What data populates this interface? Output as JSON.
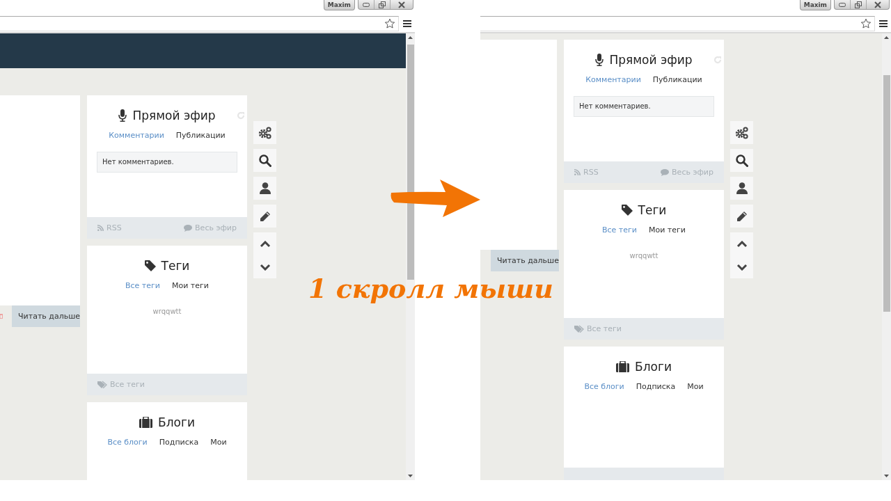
{
  "panels": [
    {
      "kind": "before",
      "user_button": "Maxim",
      "read_more": "Читать дальше",
      "live": {
        "title": "Прямой эфир",
        "tabs": [
          {
            "label": "Комментарии",
            "selected": true
          },
          {
            "label": "Публикации",
            "selected": false
          }
        ],
        "message": "Нет комментариев.",
        "footer": [
          "RSS",
          "Весь эфир"
        ]
      },
      "tags": {
        "title": "Теги",
        "tabs": [
          {
            "label": "Все теги",
            "selected": true
          },
          {
            "label": "Мои теги",
            "selected": false
          }
        ],
        "items": [
          "wrqqwtt"
        ],
        "footer": "Все теги"
      },
      "blogs": {
        "title": "Блоги",
        "tabs": [
          {
            "label": "Все блоги",
            "selected": true
          },
          {
            "label": "Подписка",
            "selected": false
          },
          {
            "label": "Мои",
            "selected": false
          }
        ]
      }
    },
    {
      "kind": "after",
      "user_button": "Maxim",
      "read_more": "Читать дальше",
      "live": {
        "title": "Прямой эфир",
        "tabs": [
          {
            "label": "Комментарии",
            "selected": true
          },
          {
            "label": "Публикации",
            "selected": false
          }
        ],
        "message": "Нет комментариев.",
        "footer": [
          "RSS",
          "Весь эфир"
        ]
      },
      "tags": {
        "title": "Теги",
        "tabs": [
          {
            "label": "Все теги",
            "selected": true
          },
          {
            "label": "Мои теги",
            "selected": false
          }
        ],
        "items": [
          "wrqqwtt"
        ],
        "footer": "Все теги"
      },
      "blogs": {
        "title": "Блоги",
        "tabs": [
          {
            "label": "Все блоги",
            "selected": true
          },
          {
            "label": "Подписка",
            "selected": false
          },
          {
            "label": "Мои",
            "selected": false
          }
        ]
      }
    }
  ],
  "caption": "1 скролл мыши"
}
